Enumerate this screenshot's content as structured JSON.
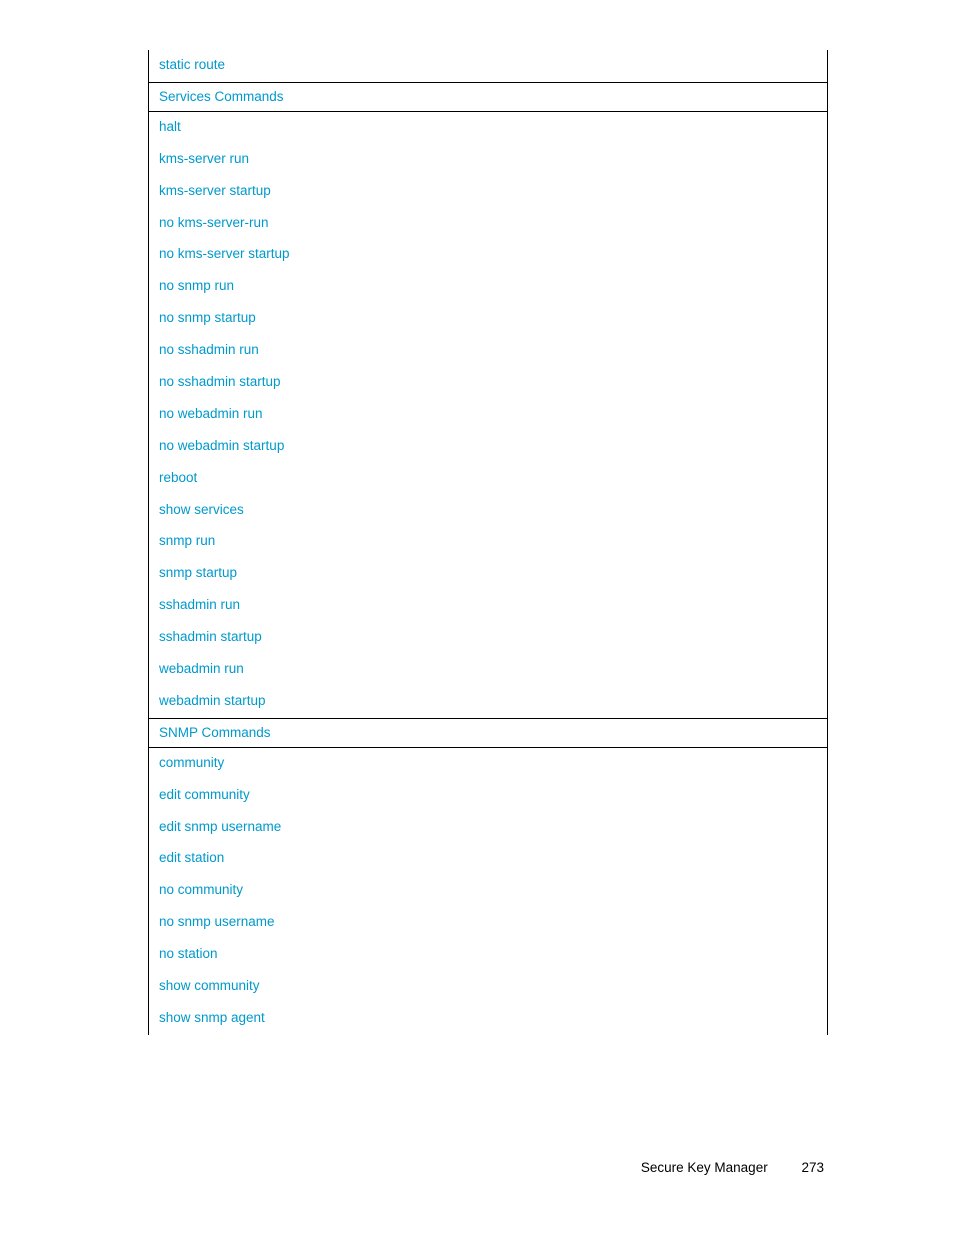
{
  "pre_items": [
    "static route"
  ],
  "sections": [
    {
      "header": "Services Commands",
      "items": [
        "halt",
        "kms-server run",
        "kms-server startup",
        "no kms-server-run",
        "no kms-server startup",
        "no snmp run",
        "no snmp startup",
        "no sshadmin run",
        "no sshadmin startup",
        "no webadmin run",
        "no webadmin startup",
        "reboot",
        "show services",
        "snmp run",
        "snmp startup",
        "sshadmin run",
        "sshadmin startup",
        "webadmin run",
        "webadmin startup"
      ]
    },
    {
      "header": "SNMP Commands",
      "items": [
        "community",
        "edit community",
        "edit snmp username",
        "edit station",
        "no community",
        "no snmp username",
        "no station",
        "show community",
        "show snmp agent"
      ]
    }
  ],
  "footer": {
    "title": "Secure Key Manager",
    "page_number": "273"
  }
}
